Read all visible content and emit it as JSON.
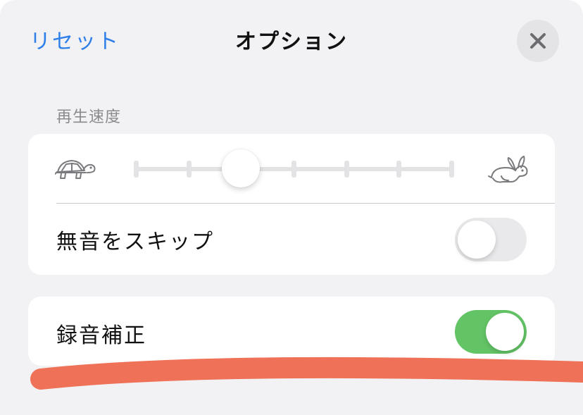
{
  "header": {
    "reset_label": "リセット",
    "title": "オプション",
    "close_icon": "close-icon"
  },
  "playback_speed": {
    "section_label": "再生速度",
    "slow_icon": "turtle-icon",
    "fast_icon": "rabbit-icon",
    "stops": 7,
    "selected_stop": 3
  },
  "toggles": {
    "skip_silence": {
      "label": "無音をスキップ",
      "on": false
    },
    "enhance_recording": {
      "label": "録音補正",
      "on": true
    }
  },
  "colors": {
    "accent": "#2f7fe9",
    "toggle_on": "#63c466",
    "annotation_stroke": "#ee6a4f"
  }
}
